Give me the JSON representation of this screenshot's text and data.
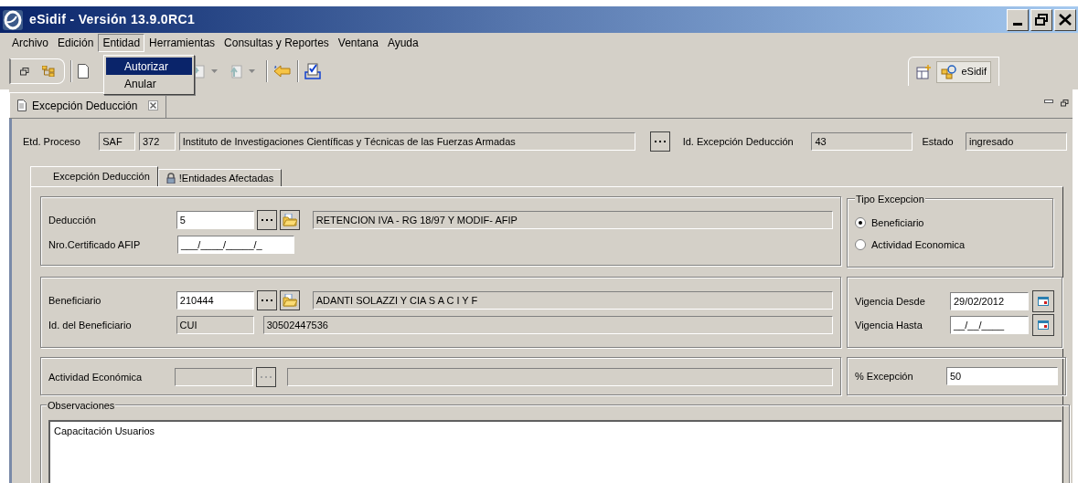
{
  "window": {
    "title": "eSidif - Versión 13.9.0RC1"
  },
  "menu": [
    {
      "label": "Archivo",
      "selected": false
    },
    {
      "label": "Edición",
      "selected": false
    },
    {
      "label": "Entidad",
      "selected": true
    },
    {
      "label": "Herramientas",
      "selected": false
    },
    {
      "label": "Consultas y Reportes",
      "selected": false
    },
    {
      "label": "Ventana",
      "selected": false
    },
    {
      "label": "Ayuda",
      "selected": false
    }
  ],
  "dropdown": [
    {
      "label": "Autorizar",
      "selected": true
    },
    {
      "label": "Anular",
      "selected": false
    }
  ],
  "perspective": {
    "label": "eSidif"
  },
  "editor_tab": {
    "title": "Excepción Deducción"
  },
  "header": {
    "etd_label": "Etd. Proceso",
    "etd_type": "SAF",
    "etd_code": "372",
    "etd_name": "Instituto de Investigaciones Científicas y Técnicas de las Fuerzas Armadas",
    "id_label": "Id. Excepción Deducción",
    "id_value": "43",
    "estado_label": "Estado",
    "estado_value": "ingresado"
  },
  "tabs": [
    {
      "label": "Excepción Deducción",
      "selected": true,
      "locked": false
    },
    {
      "label": "!Entidades Afectadas",
      "selected": false,
      "locked": true
    }
  ],
  "deduccion": {
    "label": "Deducción",
    "code": "5",
    "description": "RETENCION IVA - RG 18/97 Y MODIF- AFIP",
    "cert_label": "Nro.Certificado AFIP",
    "cert_value": "___/____/_____/_"
  },
  "tipo_excepcion": {
    "title": "Tipo Excepcion",
    "options": [
      {
        "label": "Beneficiario",
        "selected": true
      },
      {
        "label": "Actividad Economica",
        "selected": false
      }
    ]
  },
  "beneficiario": {
    "label": "Beneficiario",
    "code": "210444",
    "name": "ADANTI SOLAZZI Y CIA S A C I Y F",
    "id_label": "Id. del Beneficiario",
    "id_type": "CUI",
    "id_number": "30502447536"
  },
  "vigencia": {
    "desde_label": "Vigencia Desde",
    "desde_value": "29/02/2012",
    "hasta_label": "Vigencia Hasta",
    "hasta_value": "__/__/____"
  },
  "actividad": {
    "label": "Actividad Económica",
    "disabled": true
  },
  "excepcion": {
    "label": "% Excepción",
    "value": "50"
  },
  "observaciones": {
    "title": "Observaciones",
    "text": "Capacitación Usuarios"
  }
}
